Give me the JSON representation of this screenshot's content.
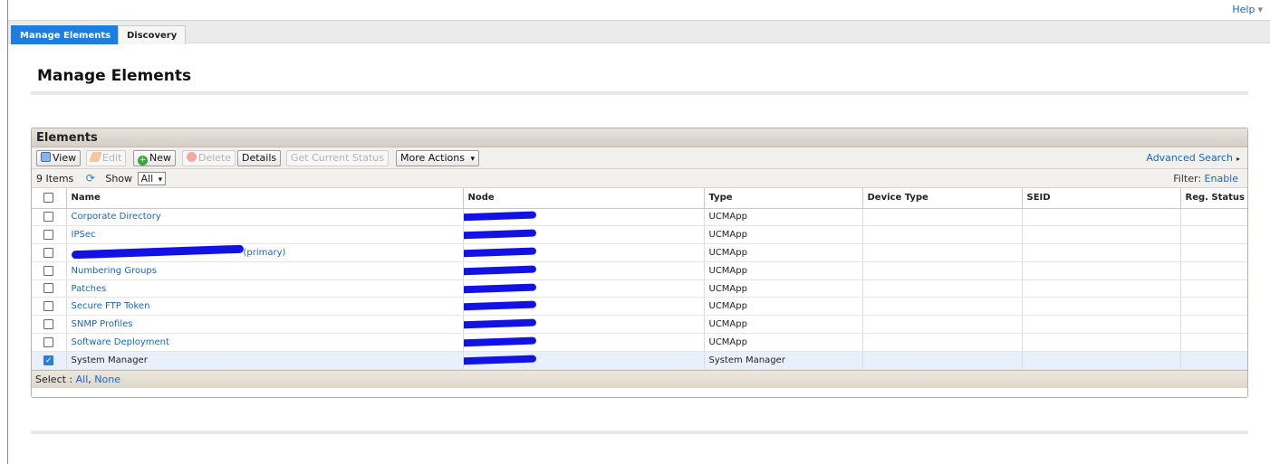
{
  "header": {
    "help_label": "Help",
    "help_caret": "▾"
  },
  "tabs": [
    {
      "label": "Manage Elements",
      "active": true
    },
    {
      "label": "Discovery",
      "active": false
    }
  ],
  "page": {
    "title": "Manage Elements"
  },
  "panel": {
    "title": "Elements",
    "toolbar": {
      "view": "View",
      "edit": "Edit",
      "new": "New",
      "delete": "Delete",
      "details": "Details",
      "get_status": "Get Current Status",
      "more_actions": "More Actions",
      "more_actions_caret": "▾",
      "advanced_search": "Advanced Search",
      "advanced_search_caret": "▸"
    },
    "info": {
      "items_count": "9 Items",
      "show_label": "Show",
      "show_value": "All",
      "show_caret": "▾",
      "filter_label": "Filter:",
      "filter_value": "Enable"
    },
    "columns": [
      "Name",
      "Node",
      "Type",
      "Device Type",
      "SEID",
      "Reg. Status"
    ],
    "rows": [
      {
        "name": "Corporate Directory",
        "type": "UCMApp",
        "checked": false,
        "link": true
      },
      {
        "name": "IPSec",
        "type": "UCMApp",
        "checked": false,
        "link": true
      },
      {
        "name": "(primary)",
        "type": "UCMApp",
        "checked": false,
        "link": true,
        "redacted_name": true
      },
      {
        "name": "Numbering Groups",
        "type": "UCMApp",
        "checked": false,
        "link": true
      },
      {
        "name": "Patches",
        "type": "UCMApp",
        "checked": false,
        "link": true
      },
      {
        "name": "Secure FTP Token",
        "type": "UCMApp",
        "checked": false,
        "link": true
      },
      {
        "name": "SNMP Profiles",
        "type": "UCMApp",
        "checked": false,
        "link": true
      },
      {
        "name": "Software Deployment",
        "type": "UCMApp",
        "checked": false,
        "link": true
      },
      {
        "name": "System Manager",
        "type": "System Manager",
        "checked": true,
        "link": false
      }
    ],
    "footer": {
      "select_label": "Select :",
      "all": "All",
      "none": "None"
    }
  },
  "colors": {
    "tab_active": "#1b7ee0",
    "link": "#1a66c2",
    "redaction": "#1212e6"
  }
}
